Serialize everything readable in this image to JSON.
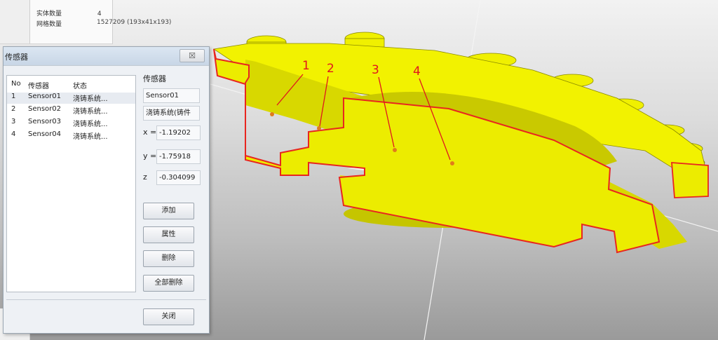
{
  "info": {
    "rows": [
      {
        "label": "实体数量",
        "value": "4"
      },
      {
        "label": "网格数量",
        "value": "1527209 (193x41x193)"
      }
    ]
  },
  "dialog": {
    "title": "传感器",
    "close_glyph": "☒",
    "list": {
      "headers": [
        "No",
        "传感器",
        "状态"
      ],
      "rows": [
        {
          "no": "1",
          "name": "Sensor01",
          "status": "浇铸系统..."
        },
        {
          "no": "2",
          "name": "Sensor02",
          "status": "浇铸系统..."
        },
        {
          "no": "3",
          "name": "Sensor03",
          "status": "浇铸系统..."
        },
        {
          "no": "4",
          "name": "Sensor04",
          "status": "浇铸系统..."
        }
      ]
    },
    "detail": {
      "label": "传感器",
      "name": "Sensor01",
      "location": "浇铸系统(铸件",
      "x_label": "x =",
      "x": "-1.19202",
      "y_label": "y =",
      "y": "-1.75918",
      "z_label": "z",
      "z": "-0.304099"
    },
    "buttons": {
      "add": "添加",
      "properties": "属性",
      "delete": "删除",
      "delete_all": "全部删除",
      "close": "关闭"
    }
  },
  "markers": [
    "1",
    "2",
    "3",
    "4"
  ],
  "colors": {
    "model_fill": "#f0f000",
    "model_dark": "#c8c800",
    "outline": "#e8261f",
    "marker": "#e0161d",
    "sensor_dot": "#e07b1b"
  }
}
